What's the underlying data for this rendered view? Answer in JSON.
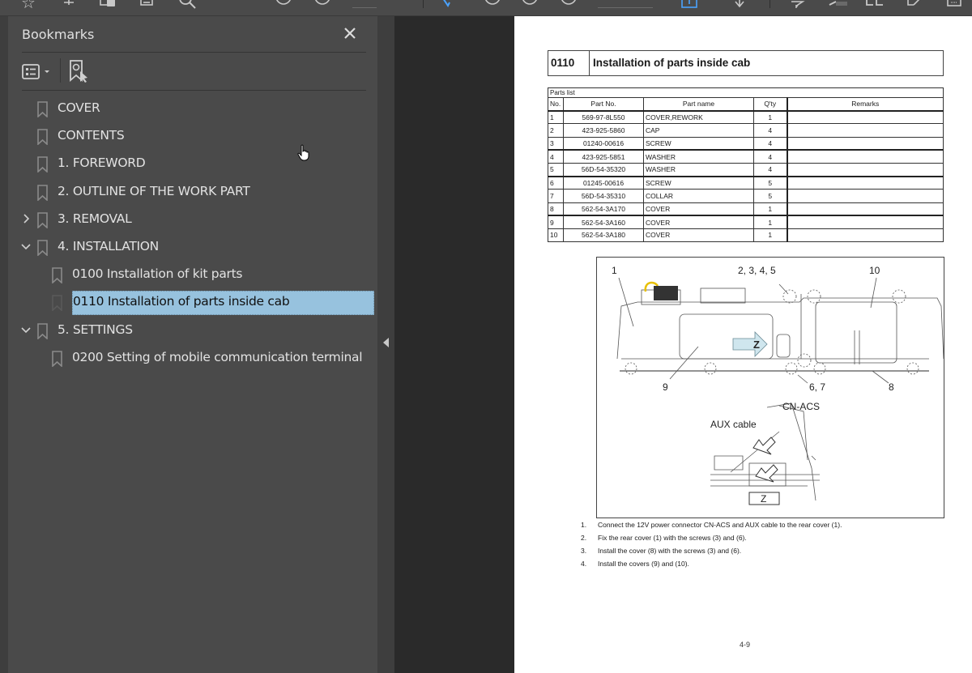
{
  "toolbar": {
    "icons": [
      "star-icon",
      "share-icon",
      "pages-icon",
      "print-icon",
      "search-icon",
      "zoom-out-icon",
      "zoom-in-icon",
      "select-icon",
      "hand-icon",
      "fit-page-icon",
      "scroll-icon",
      "comment-icon",
      "highlight-icon",
      "sign-icon",
      "edit-icon",
      "more-icon"
    ]
  },
  "sidebar": {
    "title": "Bookmarks",
    "close_label": "×",
    "items": [
      {
        "label": "COVER",
        "level": 0,
        "expander": ""
      },
      {
        "label": "CONTENTS",
        "level": 0,
        "expander": ""
      },
      {
        "label": "1. FOREWORD",
        "level": 0,
        "expander": ""
      },
      {
        "label": "2. OUTLINE OF THE WORK PART",
        "level": 0,
        "expander": ""
      },
      {
        "label": "3. REMOVAL",
        "level": 0,
        "expander": "collapsed"
      },
      {
        "label": "4. INSTALLATION",
        "level": 0,
        "expander": "expanded"
      },
      {
        "label": "0100 Installation of kit parts",
        "level": 1,
        "expander": ""
      },
      {
        "label": "0110 Installation of parts inside cab",
        "level": 1,
        "expander": "",
        "selected": true
      },
      {
        "label": "5. SETTINGS",
        "level": 0,
        "expander": "expanded"
      },
      {
        "label": "0200 Setting of mobile communication terminal",
        "level": 1,
        "expander": ""
      }
    ]
  },
  "document": {
    "section_number": "0110",
    "section_title": "Installation of parts inside cab",
    "parts_list": {
      "caption": "Parts list",
      "columns": [
        "No.",
        "Part No.",
        "Part name",
        "Q'ty",
        "Remarks"
      ],
      "rows": [
        [
          "1",
          "569-97-8L550",
          "COVER,REWORK",
          "1",
          ""
        ],
        [
          "2",
          "423-925-5860",
          "CAP",
          "4",
          ""
        ],
        [
          "3",
          "01240-00616",
          "SCREW",
          "4",
          ""
        ],
        [
          "4",
          "423-925-5851",
          "WASHER",
          "4",
          ""
        ],
        [
          "5",
          "56D-54-35320",
          "WASHER",
          "4",
          ""
        ],
        [
          "6",
          "01245-00616",
          "SCREW",
          "5",
          ""
        ],
        [
          "7",
          "56D-54-35310",
          "COLLAR",
          "5",
          ""
        ],
        [
          "8",
          "562-54-3A170",
          "COVER",
          "1",
          ""
        ],
        [
          "9",
          "562-54-3A160",
          "COVER",
          "1",
          ""
        ],
        [
          "10",
          "562-54-3A180",
          "COVER",
          "1",
          ""
        ]
      ]
    },
    "figure_labels": {
      "l1": "1",
      "l2345": "2, 3, 4, 5",
      "l10": "10",
      "l9": "9",
      "l67": "6, 7",
      "l8": "8",
      "z_arrow": "Z",
      "cn_acs": "CN-ACS",
      "aux_cable": "AUX cable",
      "z_view": "Z"
    },
    "steps": [
      {
        "n": "1.",
        "text": "Connect the 12V power connector CN-ACS and AUX cable to the rear cover (1)."
      },
      {
        "n": "2.",
        "text": "Fix the rear cover (1) with the screws (3) and (6)."
      },
      {
        "n": "3.",
        "text": "Install the cover (8) with the screws (3) and (6)."
      },
      {
        "n": "4.",
        "text": "Install the covers (9) and (10)."
      }
    ],
    "page_number": "4-9"
  }
}
